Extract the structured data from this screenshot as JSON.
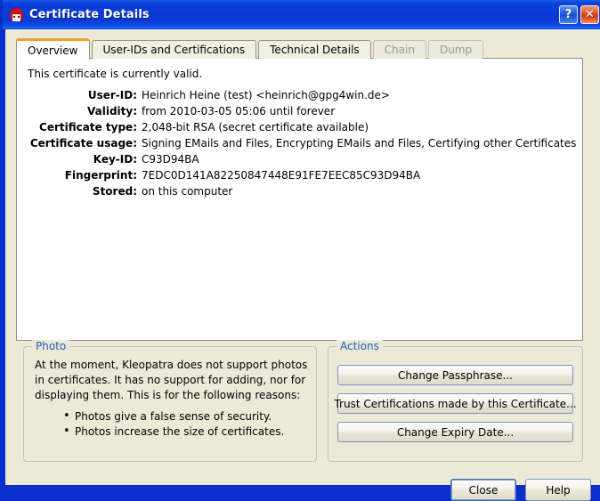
{
  "window": {
    "title": "Certificate Details",
    "icon": "kleopatra-icon",
    "help_button": "?",
    "close_button": "✕",
    "accent_blue": "#0a2ecb",
    "face_color": "#ece9d8",
    "tab_active_accent": "#f0a22e",
    "groupbox_title_color": "#1e5fb5"
  },
  "tabs": [
    {
      "label": "Overview",
      "state": "active"
    },
    {
      "label": "User-IDs and Certifications",
      "state": "enabled"
    },
    {
      "label": "Technical Details",
      "state": "enabled"
    },
    {
      "label": "Chain",
      "state": "disabled"
    },
    {
      "label": "Dump",
      "state": "disabled"
    }
  ],
  "overview": {
    "status_line": "This certificate is currently valid.",
    "fields": [
      {
        "label": "User-ID:",
        "value": "Heinrich Heine (test) <heinrich@gpg4win.de>"
      },
      {
        "label": "Validity:",
        "value": "from 2010-03-05 05:06 until forever"
      },
      {
        "label": "Certificate type:",
        "value": "2,048-bit RSA (secret certificate available)"
      },
      {
        "label": "Certificate usage:",
        "value": "Signing EMails and Files, Encrypting EMails and Files, Certifying other Certificates"
      },
      {
        "label": "Key-ID:",
        "value": "C93D94BA"
      },
      {
        "label": "Fingerprint:",
        "value": "7EDC0D141A82250847448E91FE7EEC85C93D94BA"
      },
      {
        "label": "Stored:",
        "value": "on this computer"
      }
    ]
  },
  "photo": {
    "title": "Photo",
    "paragraph": "At the moment, Kleopatra does not support photos in certificates. It has no support for adding, nor for displaying them. This is for the following reasons:",
    "bullets": [
      "Photos give a false sense of security.",
      "Photos increase the size of certificates."
    ]
  },
  "actions": {
    "title": "Actions",
    "buttons": [
      {
        "label": "Change Passphrase..."
      },
      {
        "label": "Trust Certifications made by this Certificate..."
      },
      {
        "label": "Change Expiry Date..."
      }
    ]
  },
  "footer": {
    "close_label": "Close",
    "help_label": "Help"
  }
}
